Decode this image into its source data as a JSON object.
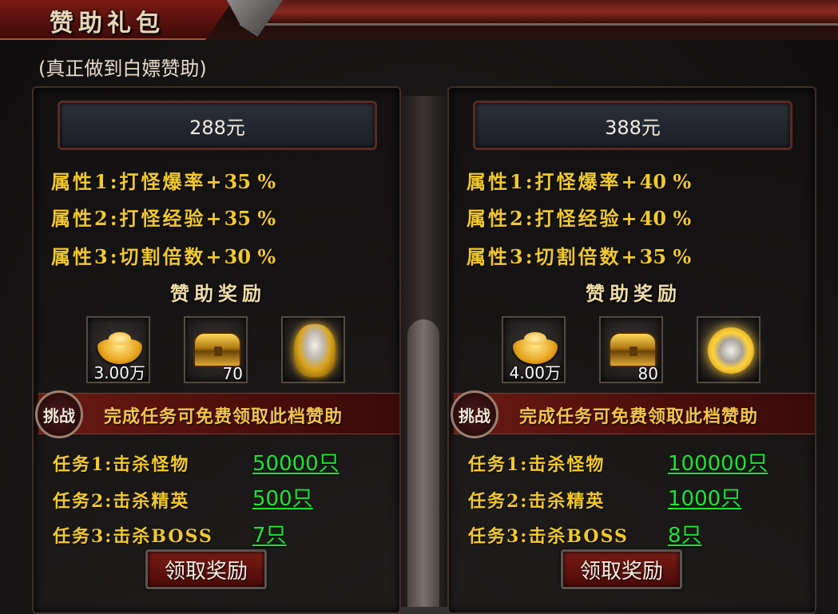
{
  "header": {
    "title": "赞助礼包"
  },
  "subtitle": "(真正做到白嫖赞助)",
  "panels": [
    {
      "price": "288元",
      "attributes": [
        {
          "label": "属性1:打怪爆率+",
          "value": "35 %"
        },
        {
          "label": "属性2:打怪经验+",
          "value": "35 %"
        },
        {
          "label": "属性3:切割倍数+",
          "value": "30 %"
        }
      ],
      "reward_title": "赞助奖励",
      "rewards": [
        {
          "icon": "gold-ingot-icon",
          "qty": "3.00万"
        },
        {
          "icon": "treasure-chest-icon",
          "qty": "70"
        },
        {
          "icon": "golden-helmet-icon",
          "qty": ""
        }
      ],
      "challenge_badge": "挑战",
      "challenge_text": "完成任务可免费领取此档赞助",
      "tasks": [
        {
          "label": "任务1:击杀怪物",
          "value": "50000只"
        },
        {
          "label": "任务2:击杀精英",
          "value": "500只"
        },
        {
          "label": "任务3:击杀BOSS",
          "value": "7只"
        }
      ],
      "claim_label": "领取奖励"
    },
    {
      "price": "388元",
      "attributes": [
        {
          "label": "属性1:打怪爆率+",
          "value": "40 %"
        },
        {
          "label": "属性2:打怪经验+",
          "value": "40 %"
        },
        {
          "label": "属性3:切割倍数+",
          "value": "35 %"
        }
      ],
      "reward_title": "赞助奖励",
      "rewards": [
        {
          "icon": "gold-ingot-icon",
          "qty": "4.00万"
        },
        {
          "icon": "treasure-chest-icon",
          "qty": "80"
        },
        {
          "icon": "golden-medal-icon",
          "qty": ""
        }
      ],
      "challenge_badge": "挑战",
      "challenge_text": "完成任务可免费领取此档赞助",
      "tasks": [
        {
          "label": "任务1:击杀怪物",
          "value": "100000只"
        },
        {
          "label": "任务2:击杀精英",
          "value": "1000只"
        },
        {
          "label": "任务3:击杀BOSS",
          "value": "8只"
        }
      ],
      "claim_label": "领取奖励"
    }
  ],
  "colors": {
    "attribute_text": "#f2c92a",
    "task_value": "#18e832",
    "accent_red": "#6a1a14"
  }
}
